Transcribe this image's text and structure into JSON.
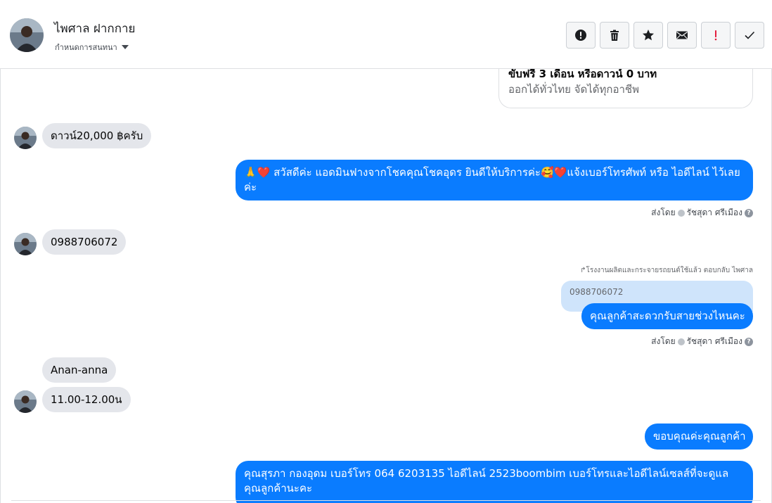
{
  "header": {
    "contact_name": "ไพศาล ฝากกาย",
    "assign_label": "กำหนดการสนทนา",
    "actions": [
      {
        "name": "spam-button",
        "icon": "alert-circle-icon"
      },
      {
        "name": "delete-button",
        "icon": "trash-icon"
      },
      {
        "name": "star-button",
        "icon": "star-icon"
      },
      {
        "name": "mark-unread-button",
        "icon": "envelope-icon"
      },
      {
        "name": "important-button",
        "icon": "exclamation-icon"
      },
      {
        "name": "mark-done-button",
        "icon": "checkmark-icon"
      }
    ]
  },
  "colors": {
    "accent": "#0a7cff",
    "incoming_bubble": "#e4e6eb",
    "important": "#e41e3f"
  },
  "thread": {
    "card": {
      "title": "ขับฟรี 3 เดือน หรือดาวน์ 0 บาท",
      "subtitle": "ออกได้ทั่วไทย จัดได้ทุกอาชีพ"
    },
    "messages": {
      "m1": "ดาวน์20,000 ฿ครับ",
      "m2": "🙏❤️ สวัสดีค่ะ แอดมินฟางจากโชคคุณโชคอุดร ยินดีให้บริการค่ะ🥰❤️แจ้งเบอร์โทรศัพท์ หรือ ไอดีไลน์  ไว้เลยค่ะ",
      "m3": "0988706072",
      "m4_reply_note": "↱โรงงานผลิตและกระจายรถยนต์ใช้แล้ว ตอบกลับ ไพศาล",
      "m4_quote": "0988706072",
      "m4": "คุณลูกค้าสะดวกรับสายช่วงไหนคะ",
      "m5": "Anan-anna",
      "m6": "11.00-12.00น",
      "m7": "ขอบคุณค่ะคุณลูกค้า",
      "m8": "คุณสุรภา กองอุดม  เบอร์โทร 064 6203135 ไอดีไลน์ 2523boombim   เบอร์โทรและไอดีไลน์เซลส์ที่จะดูแลคุณลูกค้านะคะ"
    },
    "sent_by": {
      "prefix": "ส่งโดย",
      "agent": "รัชสุดา ศรีเมือง"
    }
  }
}
